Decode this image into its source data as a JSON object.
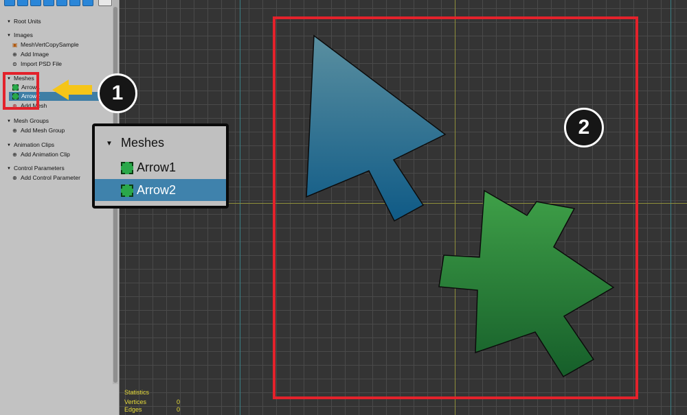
{
  "hierarchy": {
    "groups": [
      {
        "title": "Root Units",
        "items": []
      },
      {
        "title": "Images",
        "items": [
          {
            "label": "MeshVertCopySample",
            "icon": "image-icon"
          },
          {
            "label": "Add Image",
            "icon": "add-icon"
          },
          {
            "label": "Import PSD File",
            "icon": "import-icon"
          }
        ]
      },
      {
        "title": "Meshes",
        "items": [
          {
            "label": "Arrow1",
            "icon": "mesh-icon",
            "selected": false
          },
          {
            "label": "Arrow2",
            "icon": "mesh-icon",
            "selected": true
          },
          {
            "label": "Add Mesh",
            "icon": "add-icon"
          }
        ]
      },
      {
        "title": "Mesh Groups",
        "items": [
          {
            "label": "Add Mesh Group",
            "icon": "add-icon"
          }
        ]
      },
      {
        "title": "Animation Clips",
        "items": [
          {
            "label": "Add Animation Clip",
            "icon": "add-icon"
          }
        ]
      },
      {
        "title": "Control Parameters",
        "items": [
          {
            "label": "Add Control Parameter",
            "icon": "add-icon"
          }
        ]
      }
    ]
  },
  "inset": {
    "title": "Meshes",
    "items": [
      "Arrow1",
      "Arrow2"
    ],
    "selected_index": 1
  },
  "annotations": {
    "badge1": "1",
    "badge2": "2"
  },
  "statistics": {
    "title": "Statistics",
    "rows": [
      {
        "label": "Vertices",
        "value": "0"
      },
      {
        "label": "Edges",
        "value": "0"
      }
    ]
  },
  "colors": {
    "highlight": "#e3222b",
    "selection": "#3e7ea5",
    "arrow_blue_top": "#5a8fa0",
    "arrow_blue_bottom": "#0f5a86",
    "arrow_green_top": "#3fa048",
    "arrow_green_bottom": "#165e2a",
    "callout_arrow": "#f5c518"
  }
}
